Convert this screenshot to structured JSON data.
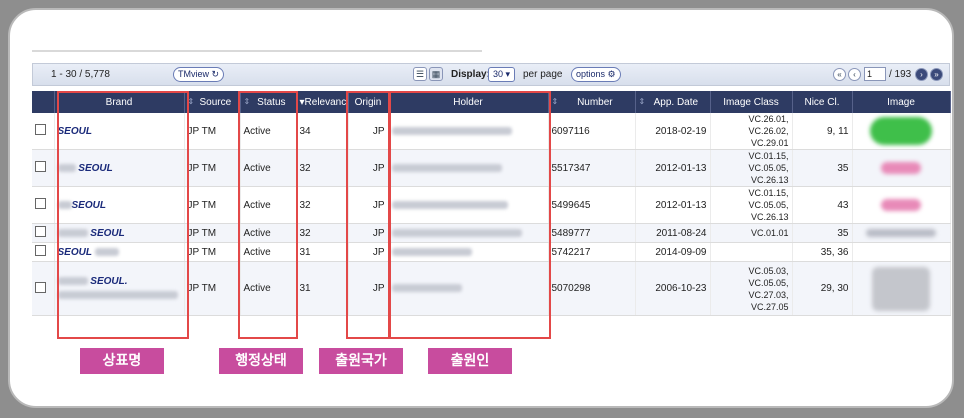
{
  "toolbar": {
    "range": "1 - 30 / 5,778",
    "tmview": "TMview",
    "display_label": "Display:",
    "display_value": "30",
    "per_page": "per page",
    "options": "options",
    "page_input": "1",
    "page_total": "/ 193"
  },
  "columns": [
    "",
    "Brand",
    "Source",
    "Status",
    "Relevance",
    "Origin",
    "Holder",
    "Number",
    "App. Date",
    "Image Class",
    "Nice Cl.",
    "Image"
  ],
  "rows": [
    {
      "brand": "SEOUL",
      "source": "JP TM",
      "status": "Active",
      "relevance": "34",
      "origin": "JP",
      "number": "6097116",
      "app_date": "2018-02-19",
      "image_class": "VC.26.01, VC.26.02, VC.29.01",
      "nice": "9, 11",
      "image_color": "#3fbf4a"
    },
    {
      "brand": "SEOUL",
      "source": "JP TM",
      "status": "Active",
      "relevance": "32",
      "origin": "JP",
      "number": "5517347",
      "app_date": "2012-01-13",
      "image_class": "VC.01.15, VC.05.05, VC.26.13",
      "nice": "35",
      "image_color": "#e88ab8"
    },
    {
      "brand": "SEOUL",
      "source": "JP TM",
      "status": "Active",
      "relevance": "32",
      "origin": "JP",
      "number": "5499645",
      "app_date": "2012-01-13",
      "image_class": "VC.01.15, VC.05.05, VC.26.13",
      "nice": "43",
      "image_color": "#e88ab8"
    },
    {
      "brand": "SEOUL",
      "source": "JP TM",
      "status": "Active",
      "relevance": "32",
      "origin": "JP",
      "number": "5489777",
      "app_date": "2011-08-24",
      "image_class": "VC.01.01",
      "nice": "35",
      "image_color": "#b9bcc6"
    },
    {
      "brand": "SEOUL",
      "source": "JP TM",
      "status": "Active",
      "relevance": "31",
      "origin": "JP",
      "number": "5742217",
      "app_date": "2014-09-09",
      "image_class": "",
      "nice": "35, 36",
      "image_color": ""
    },
    {
      "brand": "SEOUL.",
      "source": "JP TM",
      "status": "Active",
      "relevance": "31",
      "origin": "JP",
      "number": "5070298",
      "app_date": "2006-10-23",
      "image_class": "VC.05.03, VC.05.05, VC.27.03, VC.27.05",
      "nice": "29, 30",
      "image_color": "#c4c6cc"
    }
  ],
  "tags": {
    "brand": "상표명",
    "status": "행정상태",
    "origin": "출원국가",
    "holder": "출원인"
  }
}
